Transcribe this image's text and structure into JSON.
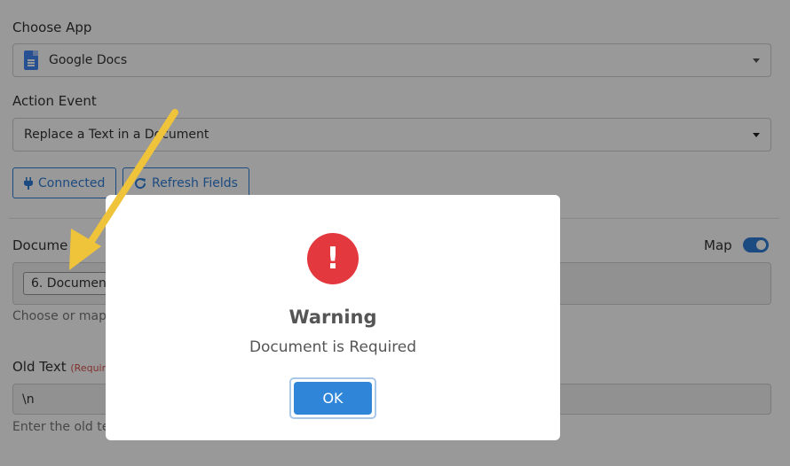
{
  "form": {
    "choose_app_label": "Choose App",
    "app_value": "Google Docs",
    "action_event_label": "Action Event",
    "action_value": "Replace a Text in a Document",
    "connected_label": "Connected",
    "refresh_label": "Refresh Fields",
    "document_label": "Docume",
    "map_label": "Map",
    "document_chip": "6. Document",
    "document_hint": "Choose or map",
    "old_text_label": "Old Text",
    "old_text_required": "(Require",
    "old_text_value": "\\n",
    "old_text_hint": "Enter the old te"
  },
  "modal": {
    "icon_glyph": "!",
    "title": "Warning",
    "message": "Document is Required",
    "ok_label": "OK"
  },
  "colors": {
    "accent": "#2f7ed8",
    "warning": "#e4383f",
    "annotation_arrow": "#f0c43a"
  },
  "icons": {
    "app": "google-docs-icon",
    "connected": "plug-icon",
    "refresh": "refresh-icon",
    "warning": "exclamation-circle-icon"
  }
}
